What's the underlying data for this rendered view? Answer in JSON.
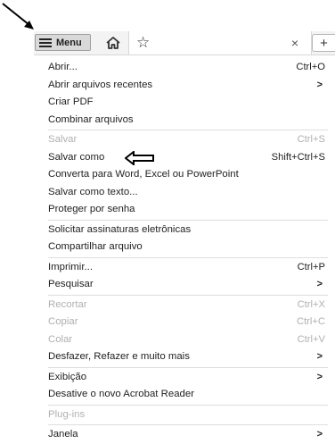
{
  "toolbar": {
    "menu_label": "Menu",
    "close_label": "×",
    "new_tab_label": "+"
  },
  "menu": {
    "groups": [
      [
        {
          "label": "Abrir...",
          "shortcut": "Ctrl+O",
          "disabled": false,
          "submenu": false
        },
        {
          "label": "Abrir arquivos recentes",
          "shortcut": "",
          "disabled": false,
          "submenu": true
        },
        {
          "label": "Criar PDF",
          "shortcut": "",
          "disabled": false,
          "submenu": false
        },
        {
          "label": "Combinar arquivos",
          "shortcut": "",
          "disabled": false,
          "submenu": false
        }
      ],
      [
        {
          "label": "Salvar",
          "shortcut": "Ctrl+S",
          "disabled": true,
          "submenu": false
        },
        {
          "label": "Salvar como",
          "shortcut": "Shift+Ctrl+S",
          "disabled": false,
          "submenu": false
        },
        {
          "label": "Converta para Word, Excel ou PowerPoint",
          "shortcut": "",
          "disabled": false,
          "submenu": false
        },
        {
          "label": "Salvar como texto...",
          "shortcut": "",
          "disabled": false,
          "submenu": false
        },
        {
          "label": "Proteger por senha",
          "shortcut": "",
          "disabled": false,
          "submenu": false
        }
      ],
      [
        {
          "label": "Solicitar assinaturas eletrônicas",
          "shortcut": "",
          "disabled": false,
          "submenu": false
        },
        {
          "label": "Compartilhar arquivo",
          "shortcut": "",
          "disabled": false,
          "submenu": false
        }
      ],
      [
        {
          "label": "Imprimir...",
          "shortcut": "Ctrl+P",
          "disabled": false,
          "submenu": false
        },
        {
          "label": "Pesquisar",
          "shortcut": "",
          "disabled": false,
          "submenu": true
        }
      ],
      [
        {
          "label": "Recortar",
          "shortcut": "Ctrl+X",
          "disabled": true,
          "submenu": false
        },
        {
          "label": "Copiar",
          "shortcut": "Ctrl+C",
          "disabled": true,
          "submenu": false
        },
        {
          "label": "Colar",
          "shortcut": "Ctrl+V",
          "disabled": true,
          "submenu": false
        },
        {
          "label": "Desfazer, Refazer e muito mais",
          "shortcut": "",
          "disabled": false,
          "submenu": true
        }
      ],
      [
        {
          "label": "Exibição",
          "shortcut": "",
          "disabled": false,
          "submenu": true
        },
        {
          "label": "Desative o novo Acrobat Reader",
          "shortcut": "",
          "disabled": false,
          "submenu": false
        }
      ],
      [
        {
          "label": "Plug-ins",
          "shortcut": "",
          "disabled": true,
          "submenu": false
        }
      ],
      [
        {
          "label": "Janela",
          "shortcut": "",
          "disabled": false,
          "submenu": true
        }
      ]
    ],
    "submenu_chevron": ">"
  },
  "icons": {
    "menu": "hamburger-icon",
    "home": "home-icon",
    "star": "star-icon",
    "pointer_arrow": "annotation-arrow-icon",
    "save_as_pointer": "annotation-left-arrow-icon"
  },
  "colors": {
    "menu_button_bg": "#d9d9d9",
    "disabled_text": "#b0b0b0",
    "text": "#222222"
  }
}
